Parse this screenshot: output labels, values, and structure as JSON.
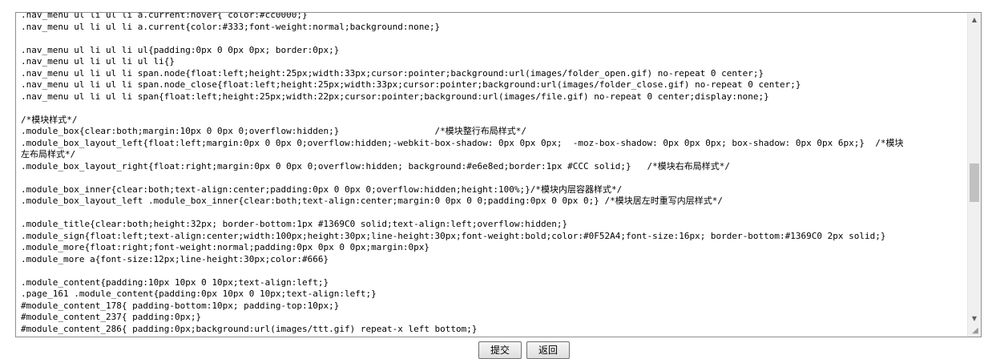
{
  "editor": {
    "lines": [
      ".nav_menu ul li ul li a.current:hover{ color:#cc0000;}",
      ".nav_menu ul li ul li a.current{color:#333;font-weight:normal;background:none;}",
      "",
      ".nav_menu ul li ul li ul{padding:0px 0 0px 0px; border:0px;}",
      ".nav_menu ul li ul li ul li{}",
      ".nav_menu ul li ul li span.node{float:left;height:25px;width:33px;cursor:pointer;background:url(images/folder_open.gif) no-repeat 0 center;}",
      ".nav_menu ul li ul li span.node_close{float:left;height:25px;width:33px;cursor:pointer;background:url(images/folder_close.gif) no-repeat 0 center;}",
      ".nav_menu ul li ul li span{float:left;height:25px;width:22px;cursor:pointer;background:url(images/file.gif) no-repeat 0 center;display:none;}",
      "",
      "/*模块样式*/",
      ".module_box{clear:both;margin:10px 0 0px 0;overflow:hidden;}                  /*模块整行布局样式*/",
      ".module_box_layout_left{float:left;margin:0px 0 0px 0;overflow:hidden;-webkit-box-shadow: 0px 0px 0px;  -moz-box-shadow: 0px 0px 0px; box-shadow: 0px 0px 6px;}  /*模块",
      "左布局样式*/",
      ".module_box_layout_right{float:right;margin:0px 0 0px 0;overflow:hidden; background:#e6e8ed;border:1px #CCC solid;}   /*模块右布局样式*/",
      "",
      ".module_box_inner{clear:both;text-align:center;padding:0px 0 0px 0;overflow:hidden;height:100%;}/*模块内层容器样式*/",
      ".module_box_layout_left .module_box_inner{clear:both;text-align:center;margin:0 0px 0 0;padding:0px 0 0px 0;} /*模块居左时重写内层样式*/",
      "",
      ".module_title{clear:both;height:32px; border-bottom:1px #1369C0 solid;text-align:left;overflow:hidden;}",
      ".module_sign{float:left;text-align:center;width:100px;height:30px;line-height:30px;font-weight:bold;color:#0F52A4;font-size:16px; border-bottom:#1369C0 2px solid;}",
      ".module_more{float:right;font-weight:normal;padding:0px 0px 0 0px;margin:0px}",
      ".module_more a{font-size:12px;line-height:30px;color:#666}",
      "",
      ".module_content{padding:10px 10px 0 10px;text-align:left;}",
      ".page_161 .module_content{padding:0px 10px 0 10px;text-align:left;}",
      "#module_content_178{ padding-bottom:10px; padding-top:10px;}",
      "#module_content_237{ padding:0px;}",
      "#module_content_286{ padding:0px;background:url(images/ttt.gif) repeat-x left bottom;}"
    ]
  },
  "buttons": {
    "submit_label": "提交",
    "back_label": "返回"
  },
  "icons": {
    "scroll_up": "scroll-up-arrow-icon",
    "scroll_down": "scroll-down-arrow-icon",
    "resize": "resize-grip-icon"
  }
}
